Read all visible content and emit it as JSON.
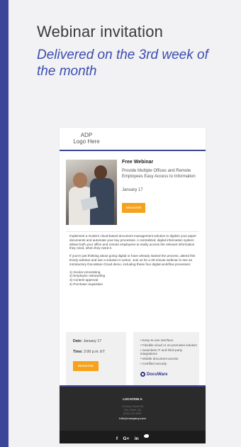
{
  "slide": {
    "title": "Webinar invitation",
    "subtitle": "Delivered on the 3rd week of the month"
  },
  "email": {
    "logo": "ADP\nLogo Here",
    "webinar_title": "Free Webinar",
    "webinar_desc": "Provide Multiple Offices and Remote Employees Easy Access to Information",
    "webinar_date": "January 17",
    "register_label": "REGISTER",
    "body_p1": "Implement a modern cloud-based document management solution to digitize your paper documents and automate your key processes. A centralized, digital information system allows both your office and remote employees to easily access the relevant information they need, when they need it.",
    "body_p2": "If you're just thinking about going digital or have already started the process, attend this timely webinar and see a solution in action. Join us for a 30-minute webinar to see an introductory DocuWare Cloud demo, including these four digital workflow processes:",
    "steps": [
      "1) Invoice processing",
      "2) Employee onboarding",
      "3) Content approval",
      "4) Purchase requisition"
    ],
    "details": {
      "date_label": "Date:",
      "date_value": "January 17",
      "time_label": "Time:",
      "time_value": "2:00 p.m. ET",
      "register_label": "REGISTER"
    },
    "features": [
      "• Easy-to-use interface",
      "• Flexible cloud or on-premises solution",
      "• Seamless IT and third-party integrations",
      "• Mobile document access",
      "• Certified security"
    ],
    "brand": "DocuWare",
    "footer": {
      "location": "LOCATION A",
      "address": "123 Any Street Rd\nCity, State, Zip",
      "phone": "(000) 123-4567",
      "email": "info@company.com",
      "social": [
        "f",
        "G+",
        "in"
      ]
    }
  },
  "colors": {
    "brand_blue": "#3b4699",
    "accent_orange": "#f7a21b",
    "subtitle_blue": "#3b4db0"
  }
}
